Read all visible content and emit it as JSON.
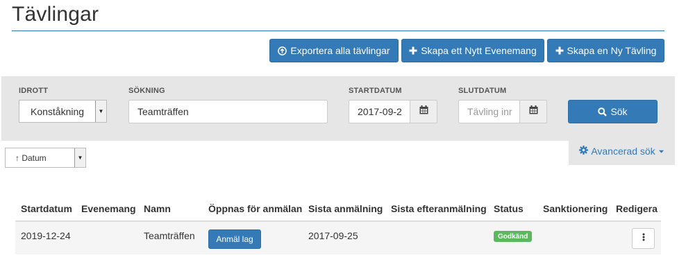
{
  "page": {
    "title": "Tävlingar"
  },
  "actions": {
    "export_all": "Exportera alla tävlingar",
    "create_event": "Skapa ett Nytt Evenemang",
    "create_competition": "Skapa en Ny Tävling"
  },
  "filters": {
    "sport": {
      "label": "IDROTT",
      "value": "Konståkning"
    },
    "search": {
      "label": "SÖKNING",
      "value": "Teamträffen"
    },
    "start_date": {
      "label": "STARTDATUM",
      "value": "2017-09-2"
    },
    "end_date": {
      "label": "SLUTDATUM",
      "placeholder": "Tävling inr"
    },
    "search_button": "Sök"
  },
  "sort": {
    "value": "↑ Datum"
  },
  "advanced_search": "Avancerad sök",
  "table": {
    "headers": [
      "Startdatum",
      "Evenemang",
      "Namn",
      "Öppnas för anmälan",
      "Sista anmälning",
      "Sista efteranmälning",
      "Status",
      "Sanktionering",
      "Redigera"
    ],
    "rows": [
      {
        "startdatum": "2019-12-24",
        "evenemang": "",
        "namn": "Teamträffen",
        "register_button": "Anmäl lag",
        "sista_anmalning": "2017-09-25",
        "sista_efteranmalning": "",
        "status": "Godkänd",
        "sanktionering": ""
      }
    ]
  },
  "colors": {
    "primary": "#337ab7",
    "success": "#5cb85c",
    "panel": "#e6e6e6"
  },
  "icons": [
    "upload-circle-icon",
    "plus-icon",
    "calendar-icon",
    "search-icon",
    "gear-icon",
    "caret-down-icon",
    "vertical-ellipsis-icon"
  ]
}
